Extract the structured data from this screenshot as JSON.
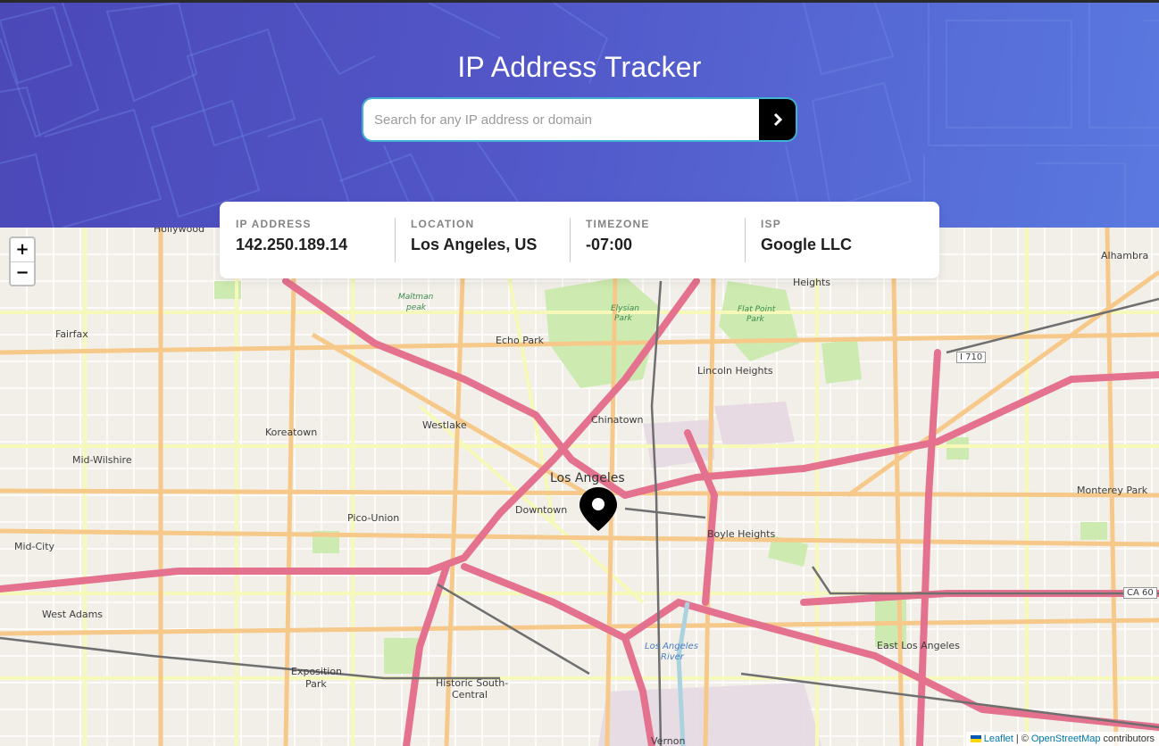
{
  "app": {
    "title": "IP Address Tracker"
  },
  "search": {
    "placeholder": "Search for any IP address or domain",
    "value": ""
  },
  "info": [
    {
      "label": "IP ADDRESS",
      "value": "142.250.189.14"
    },
    {
      "label": "LOCATION",
      "value": "Los Angeles, US"
    },
    {
      "label": "TIMEZONE",
      "value": "-07:00"
    },
    {
      "label": "ISP",
      "value": "Google LLC"
    }
  ],
  "map": {
    "zoom_in": "+",
    "zoom_out": "−",
    "labels": {
      "hollywood": "Hollywood",
      "alhambra": "Alhambra",
      "heights": "Heights",
      "maltman": "Maltman",
      "peak": "peak",
      "fairfax": "Fairfax",
      "echo_park": "Echo Park",
      "elysian": "Elysian",
      "park1": "Park",
      "flat_point": "Flat Point",
      "park2": "Park",
      "lincoln_heights": "Lincoln Heights",
      "westlake": "Westlake",
      "chinatown": "Chinatown",
      "koreatown": "Koreatown",
      "mid_wilshire": "Mid-Wilshire",
      "los_angeles": "Los Angeles",
      "downtown": "Downtown",
      "pico_union": "Pico-Union",
      "boyle_heights": "Boyle Heights",
      "monterey_park": "Monterey Park",
      "mid_city": "Mid-City",
      "west_adams": "West Adams",
      "exposition": "Exposition",
      "park3": "Park",
      "historic": "Historic South-",
      "central": "Central",
      "east_la": "East Los Angeles",
      "la_river": "Los Angeles",
      "river": "River",
      "vernon": "Vernon",
      "i710": "I 710",
      "ca60": "CA 60"
    },
    "attribution": {
      "leaflet": "Leaflet",
      "separator": "| ©",
      "osm": "OpenStreetMap",
      "suffix": "contributors"
    }
  },
  "colors": {
    "header_start": "#4b48b8",
    "header_end": "#5a79e0",
    "search_border": "#3fb3d4",
    "button": "#000000",
    "highway": "#e4728f",
    "primary_road": "#f6c98a",
    "secondary_road": "#f7f9b8",
    "map_bg": "#f2efe9"
  },
  "icons": {
    "search_button": "chevron-right-icon",
    "marker": "location-pin-icon"
  }
}
